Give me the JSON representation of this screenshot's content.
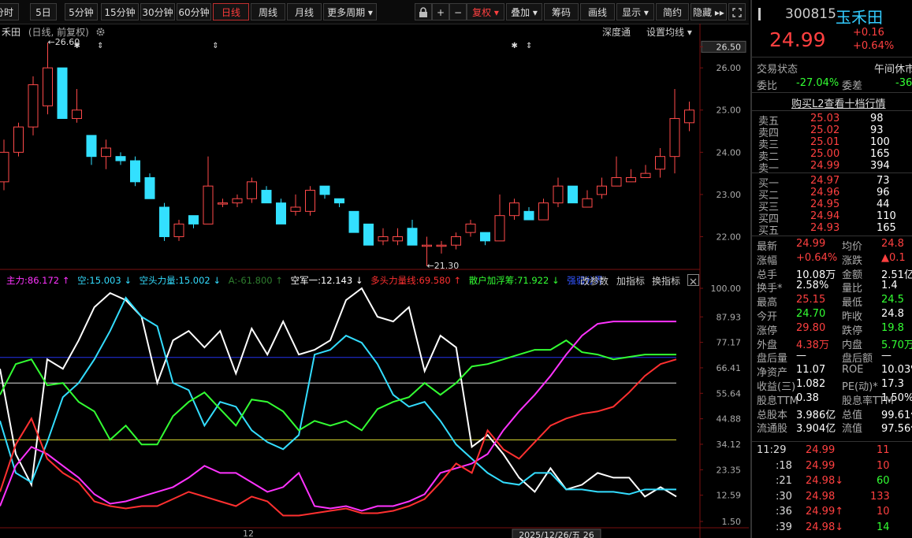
{
  "toolbar": {
    "periods": [
      "分时",
      "5日",
      "5分钟",
      "15分钟",
      "30分钟",
      "60分钟",
      "日线",
      "周线",
      "月线",
      "更多周期"
    ],
    "active_period": "日线",
    "lock_icon": "lock-icon",
    "plus": "+",
    "minus": "−",
    "fuquan": "复权",
    "tools": [
      "叠加",
      "筹码",
      "画线",
      "显示",
      "简约",
      "隐藏"
    ],
    "expand_icon": "expand-icon"
  },
  "chart_header": {
    "name": "禾田",
    "sub": "(日线, 前复权)",
    "depth": "深度通",
    "ma_set": "设置均线"
  },
  "price_axis": [
    "26.50",
    "26.00",
    "25.00",
    "24.00",
    "23.00",
    "22.00"
  ],
  "markers": {
    "high_label": "26.60",
    "low_label": "21.30"
  },
  "indicator_legend": [
    {
      "text": "主力:86.172",
      "color": "#ff33ff",
      "arrow": "↑"
    },
    {
      "text": "空:15.003",
      "color": "#33ddff",
      "arrow": "↓"
    },
    {
      "text": "空头力量:15.002",
      "color": "#33ddff",
      "arrow": "↓"
    },
    {
      "text": "A:-61.800",
      "color": "#2e7d2e",
      "arrow": "↑"
    },
    {
      "text": "空军一:12.143",
      "color": "#ffffff",
      "arrow": "↓"
    },
    {
      "text": "多头力量线:69.580",
      "color": "#ff3030",
      "arrow": "↑"
    },
    {
      "text": "散户加浮筹:71.922",
      "color": "#33ff33",
      "arrow": "↓"
    },
    {
      "text": "强弱分界",
      "color": "#3355ff",
      "arrow": ""
    }
  ],
  "indicator_buttons": [
    "改参数",
    "加指标",
    "换指标"
  ],
  "indicator_axis": [
    "100.00",
    "87.93",
    "77.17",
    "66.41",
    "55.64",
    "44.88",
    "34.12",
    "23.35",
    "12.59",
    "1.50"
  ],
  "x_axis": {
    "label": "12",
    "date_box": "2025/12/26/五 26"
  },
  "stock": {
    "code": "300815",
    "name": "玉禾田",
    "price": "24.99",
    "change": "+0.16",
    "pct": "+0.64%"
  },
  "status": {
    "label": "交易状态",
    "value": "午间休市"
  },
  "weibi": {
    "label": "委比",
    "value": "-27.04%",
    "label2": "委差",
    "value2": "-36"
  },
  "l2_link": "购买L2查看十档行情",
  "asks": [
    {
      "label": "卖五",
      "price": "25.03",
      "vol": "98"
    },
    {
      "label": "卖四",
      "price": "25.02",
      "vol": "93"
    },
    {
      "label": "卖三",
      "price": "25.01",
      "vol": "100"
    },
    {
      "label": "卖二",
      "price": "25.00",
      "vol": "165"
    },
    {
      "label": "卖一",
      "price": "24.99",
      "vol": "394"
    }
  ],
  "bids": [
    {
      "label": "买一",
      "price": "24.97",
      "vol": "73"
    },
    {
      "label": "买二",
      "price": "24.96",
      "vol": "96"
    },
    {
      "label": "买三",
      "price": "24.95",
      "vol": "44"
    },
    {
      "label": "买四",
      "price": "24.94",
      "vol": "110"
    },
    {
      "label": "买五",
      "price": "24.93",
      "vol": "165"
    }
  ],
  "stats": [
    {
      "l1": "最新",
      "v1": "24.99",
      "c1": "#ff4040",
      "l2": "均价",
      "v2": "24.8",
      "c2": "#ff4040"
    },
    {
      "l1": "涨幅",
      "v1": "+0.64%",
      "c1": "#ff4040",
      "l2": "涨跌",
      "v2": "▲0.1",
      "c2": "#ff4040"
    },
    {
      "l1": "总手",
      "v1": "10.08万",
      "c1": "#ffffff",
      "l2": "金额",
      "v2": "2.51亿",
      "c2": "#ffffff"
    },
    {
      "l1": "换手*",
      "v1": "2.58%",
      "c1": "#ffffff",
      "l2": "量比",
      "v2": "1.4",
      "c2": "#ffffff"
    },
    {
      "l1": "最高",
      "v1": "25.15",
      "c1": "#ff4040",
      "l2": "最低",
      "v2": "24.5",
      "c2": "#33ff33"
    },
    {
      "l1": "今开",
      "v1": "24.70",
      "c1": "#33ff33",
      "l2": "昨收",
      "v2": "24.8",
      "c2": "#ffffff"
    },
    {
      "l1": "涨停",
      "v1": "29.80",
      "c1": "#ff4040",
      "l2": "跌停",
      "v2": "19.8",
      "c2": "#33ff33"
    },
    {
      "l1": "外盘",
      "v1": "4.38万",
      "c1": "#ff4040",
      "l2": "内盘",
      "v2": "5.70万",
      "c2": "#33ff33"
    },
    {
      "l1": "盘后量",
      "v1": "—",
      "c1": "#ffffff",
      "l2": "盘后额",
      "v2": "—",
      "c2": "#ffffff"
    },
    {
      "l1": "净资产",
      "v1": "11.07",
      "c1": "#ffffff",
      "l2": "ROE",
      "v2": "10.03%",
      "c2": "#ffffff"
    },
    {
      "l1": "收益(三)",
      "v1": "1.082",
      "c1": "#ffffff",
      "l2": "PE(动)*",
      "v2": "17.3",
      "c2": "#ffffff"
    },
    {
      "l1": "股息TTM",
      "v1": "0.38",
      "c1": "#ffffff",
      "l2": "股息率TTM",
      "v2": "1.50%",
      "c2": "#ffffff"
    },
    {
      "l1": "总股本",
      "v1": "3.986亿",
      "c1": "#ffffff",
      "l2": "总值",
      "v2": "99.61亿",
      "c2": "#ffffff"
    },
    {
      "l1": "流通股",
      "v1": "3.904亿",
      "c1": "#ffffff",
      "l2": "流值",
      "v2": "97.56亿",
      "c2": "#ffffff"
    }
  ],
  "ticks": [
    {
      "time": "11:29",
      "price": "24.99",
      "arrow": "",
      "vol": "11",
      "vc": "#ff4040"
    },
    {
      "time": ":18",
      "price": "24.99",
      "arrow": "",
      "vol": "10",
      "vc": "#ff4040"
    },
    {
      "time": ":21",
      "price": "24.98",
      "arrow": "↓",
      "vol": "60",
      "vc": "#33ff33"
    },
    {
      "time": ":30",
      "price": "24.98",
      "arrow": "",
      "vol": "133",
      "vc": "#ff4040"
    },
    {
      "time": ":36",
      "price": "24.99",
      "arrow": "↑",
      "vol": "10",
      "vc": "#ff4040"
    },
    {
      "time": ":39",
      "price": "24.98",
      "arrow": "↓",
      "vol": "14",
      "vc": "#33ff33"
    }
  ],
  "chart_data": {
    "type": "candlestick",
    "price_ylim": [
      21.3,
      26.6
    ],
    "candles": [
      [
        23.3,
        24.0,
        24.3,
        23.1
      ],
      [
        24.0,
        24.6,
        24.7,
        23.9
      ],
      [
        24.6,
        25.6,
        25.8,
        24.4
      ],
      [
        25.1,
        26.0,
        26.6,
        24.9
      ],
      [
        26.0,
        24.8,
        26.0,
        24.8
      ],
      [
        24.8,
        25.0,
        25.5,
        24.7
      ],
      [
        24.4,
        23.9,
        24.4,
        23.7
      ],
      [
        23.9,
        24.1,
        24.3,
        23.6
      ],
      [
        23.9,
        23.8,
        24.0,
        23.7
      ],
      [
        23.8,
        23.3,
        23.9,
        23.2
      ],
      [
        23.4,
        22.9,
        23.5,
        22.9
      ],
      [
        22.7,
        22.0,
        22.8,
        21.9
      ],
      [
        22.0,
        22.3,
        22.4,
        21.9
      ],
      [
        22.5,
        22.3,
        22.5,
        22.2
      ],
      [
        22.3,
        23.2,
        23.9,
        22.3
      ],
      [
        22.8,
        22.8,
        22.9,
        22.7
      ],
      [
        22.8,
        22.9,
        23.0,
        22.7
      ],
      [
        22.9,
        23.3,
        23.4,
        22.8
      ],
      [
        23.1,
        22.8,
        23.2,
        22.8
      ],
      [
        22.8,
        22.3,
        22.9,
        22.3
      ],
      [
        22.6,
        22.7,
        23.0,
        22.5
      ],
      [
        22.6,
        23.1,
        23.2,
        22.5
      ],
      [
        23.2,
        23.0,
        23.2,
        22.9
      ],
      [
        22.9,
        22.8,
        22.9,
        22.7
      ],
      [
        22.6,
        22.1,
        22.6,
        22.1
      ],
      [
        22.3,
        21.8,
        22.3,
        21.8
      ],
      [
        21.9,
        22.0,
        22.2,
        21.8
      ],
      [
        21.9,
        22.0,
        22.2,
        21.8
      ],
      [
        22.2,
        21.8,
        22.4,
        21.8
      ],
      [
        21.8,
        21.8,
        22.0,
        21.3
      ],
      [
        21.8,
        21.8,
        21.9,
        21.6
      ],
      [
        21.8,
        22.0,
        22.1,
        21.7
      ],
      [
        22.1,
        22.3,
        22.4,
        22.0
      ],
      [
        22.1,
        21.9,
        22.1,
        21.8
      ],
      [
        21.9,
        22.5,
        23.0,
        21.9
      ],
      [
        22.5,
        22.8,
        22.9,
        22.4
      ],
      [
        22.6,
        22.4,
        22.7,
        22.4
      ],
      [
        22.4,
        22.8,
        22.9,
        22.4
      ],
      [
        22.8,
        23.2,
        23.4,
        22.7
      ],
      [
        23.2,
        22.8,
        23.2,
        22.8
      ],
      [
        22.7,
        22.9,
        23.1,
        22.7
      ],
      [
        23.0,
        23.2,
        23.4,
        22.9
      ],
      [
        23.2,
        23.4,
        23.9,
        23.2
      ],
      [
        23.3,
        23.4,
        23.6,
        23.3
      ],
      [
        23.4,
        23.5,
        23.7,
        23.4
      ],
      [
        23.6,
        23.9,
        24.1,
        23.4
      ],
      [
        23.9,
        24.8,
        25.5,
        23.5
      ],
      [
        24.7,
        25.0,
        25.2,
        24.5
      ]
    ],
    "indicator_ylim": [
      1.5,
      100
    ],
    "hlines": [
      {
        "value": 70.8,
        "color": "#2233ee"
      },
      {
        "value": 60.0,
        "color": "#dddddd"
      },
      {
        "value": 36.0,
        "color": "#dddd33"
      }
    ],
    "series": [
      {
        "name": "空军一",
        "color": "#ffffff",
        "values": [
          66,
          30,
          17,
          70,
          66,
          78,
          92,
          98,
          95,
          88,
          60,
          78,
          82,
          75,
          82,
          64,
          83,
          72,
          86,
          72,
          74,
          78,
          95,
          100,
          88,
          86,
          92,
          65,
          80,
          75,
          33,
          38,
          30,
          20,
          14,
          24,
          15,
          17,
          22,
          20,
          20,
          12,
          16,
          12
        ]
      },
      {
        "name": "空",
        "color": "#33ddff",
        "values": [
          44,
          22,
          18,
          35,
          54,
          60,
          70,
          82,
          96,
          88,
          84,
          60,
          57,
          42,
          52,
          50,
          40,
          35,
          32,
          38,
          72,
          74,
          80,
          77,
          68,
          55,
          50,
          52,
          44,
          34,
          28,
          22,
          18,
          17,
          22,
          22,
          15,
          15,
          14,
          14,
          13,
          15,
          15,
          15
        ]
      },
      {
        "name": "散户加浮筹",
        "color": "#33ff33",
        "values": [
          55,
          68,
          70,
          59,
          60,
          52,
          48,
          36,
          42,
          34,
          34,
          46,
          52,
          56,
          49,
          42,
          53,
          52,
          48,
          40,
          44,
          42,
          44,
          40,
          49,
          52,
          54,
          60,
          55,
          60,
          67,
          68,
          70,
          72,
          74,
          74,
          78,
          73,
          72,
          70,
          71,
          72,
          72,
          72
        ]
      },
      {
        "name": "主力",
        "color": "#ff33ff",
        "values": [
          8,
          25,
          33,
          30,
          25,
          20,
          13,
          9,
          10,
          12,
          14,
          16,
          20,
          25,
          22,
          22,
          18,
          14,
          16,
          22,
          8,
          7,
          8,
          6,
          8,
          8,
          10,
          13,
          22,
          24,
          26,
          30,
          40,
          48,
          55,
          63,
          72,
          80,
          85,
          86,
          86,
          86,
          86,
          86
        ]
      },
      {
        "name": "多头力量线",
        "color": "#ff3030",
        "values": [
          14,
          34,
          45,
          28,
          22,
          18,
          10,
          8,
          7,
          8,
          8,
          11,
          14,
          12,
          10,
          8,
          12,
          10,
          4,
          4,
          5,
          6,
          7,
          5,
          5,
          6,
          8,
          11,
          18,
          26,
          22,
          40,
          32,
          28,
          35,
          42,
          45,
          47,
          48,
          50,
          56,
          63,
          68,
          70
        ]
      }
    ]
  }
}
